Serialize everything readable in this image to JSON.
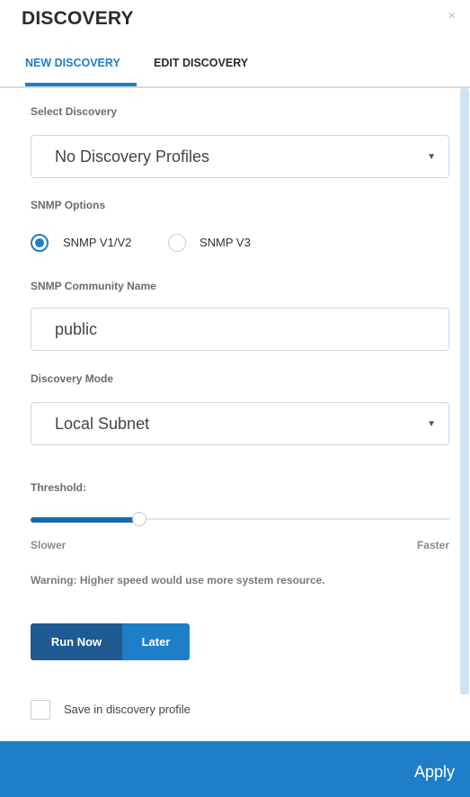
{
  "header": {
    "title": "DISCOVERY",
    "close_glyph": "×",
    "tabs": [
      {
        "label": "NEW DISCOVERY",
        "active": true
      },
      {
        "label": "EDIT DISCOVERY",
        "active": false
      }
    ]
  },
  "form": {
    "select_discovery": {
      "label": "Select Discovery",
      "value": "No Discovery Profiles"
    },
    "snmp_options": {
      "label": "SNMP Options",
      "options": [
        {
          "label": "SNMP V1/V2",
          "checked": true
        },
        {
          "label": "SNMP V3",
          "checked": false
        }
      ]
    },
    "community_name": {
      "label": "SNMP Community Name",
      "value": "public"
    },
    "discovery_mode": {
      "label": "Discovery Mode",
      "value": "Local Subnet"
    },
    "threshold": {
      "label": "Threshold:",
      "value_fraction": 0.26,
      "min_label": "Slower",
      "max_label": "Faster"
    },
    "warning": "Warning: Higher speed would use more system resource.",
    "buttons": {
      "run_now": "Run Now",
      "later": "Later"
    },
    "save_profile": {
      "label": "Save in discovery profile",
      "checked": false
    }
  },
  "footer": {
    "apply_label": "Apply"
  },
  "colors": {
    "accent": "#1e7ec8",
    "accent_dark": "#1f5a92",
    "scrollbar": "#cfe2f3"
  },
  "icons": {
    "caret": "chevron-down-icon",
    "close": "close-icon"
  }
}
